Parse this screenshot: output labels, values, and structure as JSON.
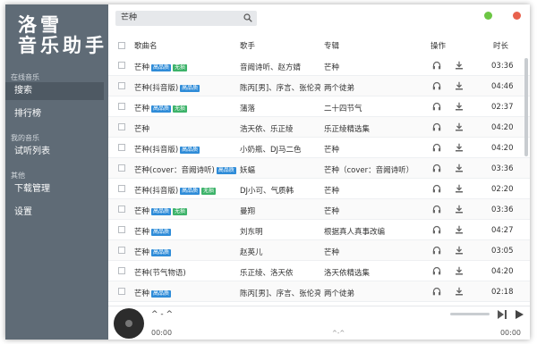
{
  "app": {
    "logo_line1": "洛雪",
    "logo_line2": "音乐助手"
  },
  "sidebar": {
    "groups": [
      {
        "title": "在线音乐",
        "items": [
          {
            "label": "搜索"
          },
          {
            "label": "排行榜"
          }
        ]
      },
      {
        "title": "我的音乐",
        "items": [
          {
            "label": "试听列表"
          }
        ]
      },
      {
        "title": "其他",
        "items": [
          {
            "label": "下载管理"
          },
          {
            "label": "设置"
          }
        ]
      }
    ]
  },
  "search": {
    "value": "芒种",
    "icon": "search-icon"
  },
  "window_controls": {
    "min_color": "#6cc644",
    "close_color": "#e8614d"
  },
  "table": {
    "headers": {
      "name": "歌曲名",
      "artist": "歌手",
      "album": "专辑",
      "ops": "操作",
      "duration": "时长"
    },
    "rows": [
      {
        "name": "芒种",
        "hq": "高品质",
        "lossless": "无损",
        "artist": "音阙诗听、赵方婧",
        "album": "芒种",
        "duration": "03:36"
      },
      {
        "name": "芒种(抖音版)",
        "hq": "高品质",
        "lossless": "",
        "artist": "陈丙[男]、序言、张伦亮",
        "album": "两个徒弟",
        "duration": "04:46"
      },
      {
        "name": "芒种",
        "hq": "高品质",
        "lossless": "无损",
        "artist": "蒲落",
        "album": "二十四节气",
        "duration": "02:37"
      },
      {
        "name": "芒种",
        "hq": "",
        "lossless": "",
        "artist": "浩天依、乐正绫",
        "album": "乐正绫精选集",
        "duration": "04:20"
      },
      {
        "name": "芒种(抖音版)",
        "hq": "高品质",
        "lossless": "",
        "artist": "小奶瓶、DJ马二色",
        "album": "芒种",
        "duration": "04:20"
      },
      {
        "name": "芒种(cover：音阙诗听)",
        "hq": "高品质",
        "lossless": "无损",
        "artist": "妖蝠",
        "album": "芒种（cover：音阙诗听）",
        "duration": "03:36"
      },
      {
        "name": "芒种(抖音版)",
        "hq": "高品质",
        "lossless": "无损",
        "artist": "DJ小可、气质韩",
        "album": "芒种",
        "duration": "02:20"
      },
      {
        "name": "芒种",
        "hq": "高品质",
        "lossless": "无损",
        "artist": "曼翔",
        "album": "芒种",
        "duration": "03:36"
      },
      {
        "name": "芒种",
        "hq": "高品质",
        "lossless": "",
        "artist": "刘东明",
        "album": "根据真人真事改编",
        "duration": "04:27"
      },
      {
        "name": "芒种",
        "hq": "高品质",
        "lossless": "",
        "artist": "赵英儿",
        "album": "芒种",
        "duration": "03:05"
      },
      {
        "name": "芒种(节气物语)",
        "hq": "",
        "lossless": "",
        "artist": "乐正绫、洛天依",
        "album": "洛天依精选集",
        "duration": "04:20"
      },
      {
        "name": "芒种",
        "hq": "高品质",
        "lossless": "",
        "artist": "陈丙[男]、序言、张伦亮",
        "album": "两个徒弟",
        "duration": "02:18"
      }
    ]
  },
  "player": {
    "title": "^ - ^",
    "time_current": "00:00",
    "time_total": "00:00",
    "center_mark": "^-^"
  }
}
